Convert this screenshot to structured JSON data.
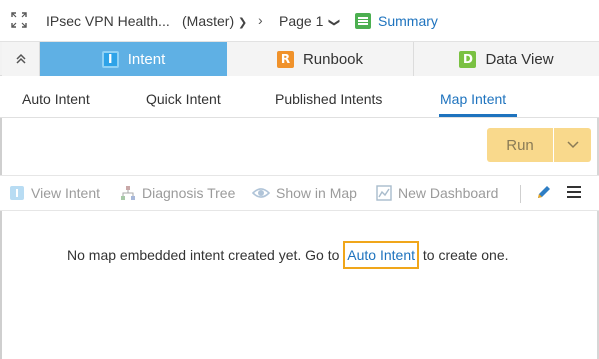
{
  "breadcrumb": {
    "title": "IPsec VPN Health...",
    "branch": "(Master)",
    "page": "Page 1",
    "summary": "Summary"
  },
  "tabs": [
    {
      "label": "Intent",
      "badge": "I",
      "active": true
    },
    {
      "label": "Runbook",
      "badge": "R",
      "active": false
    },
    {
      "label": "Data View",
      "badge": "D",
      "active": false
    }
  ],
  "subtabs": [
    {
      "label": "Auto Intent",
      "active": false
    },
    {
      "label": "Quick Intent",
      "active": false
    },
    {
      "label": "Published Intents",
      "active": false
    },
    {
      "label": "Map Intent",
      "active": true
    }
  ],
  "run": {
    "label": "Run"
  },
  "toolbar": {
    "view_intent": "View Intent",
    "diagnosis_tree": "Diagnosis Tree",
    "show_in_map": "Show in Map",
    "new_dashboard": "New Dashboard"
  },
  "message": {
    "before": "No map embedded intent created yet. Go to ",
    "link": "Auto Intent",
    "after": " to create one."
  },
  "colors": {
    "accent": "#1e73be",
    "tab_active": "#5fb0e4",
    "run_button": "#f9d98c",
    "highlight_border": "#f0a61a"
  }
}
